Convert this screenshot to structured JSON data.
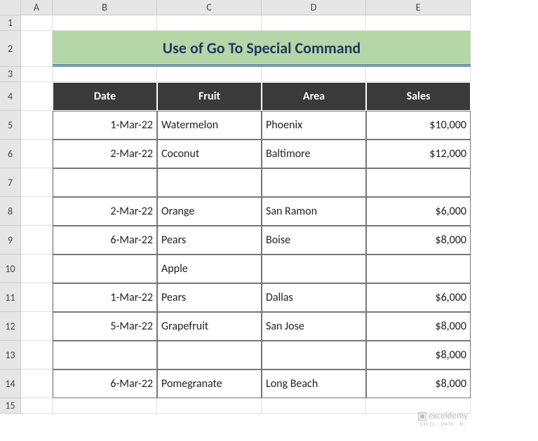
{
  "columns": [
    "A",
    "B",
    "C",
    "D",
    "E"
  ],
  "rows": [
    "1",
    "2",
    "3",
    "4",
    "5",
    "6",
    "7",
    "8",
    "9",
    "10",
    "11",
    "12",
    "13",
    "14",
    "15"
  ],
  "title": "Use of Go To Special Command",
  "headers": {
    "date": "Date",
    "fruit": "Fruit",
    "area": "Area",
    "sales": "Sales"
  },
  "chart_data": {
    "type": "table",
    "columns": [
      "Date",
      "Fruit",
      "Area",
      "Sales"
    ],
    "rows": [
      {
        "date": "1-Mar-22",
        "fruit": "Watermelon",
        "area": "Phoenix",
        "sales": "$10,000"
      },
      {
        "date": "2-Mar-22",
        "fruit": "Coconut",
        "area": "Baltimore",
        "sales": "$12,000"
      },
      {
        "date": "",
        "fruit": "",
        "area": "",
        "sales": ""
      },
      {
        "date": "2-Mar-22",
        "fruit": "Orange",
        "area": "San Ramon",
        "sales": "$6,000"
      },
      {
        "date": "6-Mar-22",
        "fruit": "Pears",
        "area": "Boise",
        "sales": "$8,000"
      },
      {
        "date": "",
        "fruit": "Apple",
        "area": "",
        "sales": ""
      },
      {
        "date": "1-Mar-22",
        "fruit": "Pears",
        "area": "Dallas",
        "sales": "$6,000"
      },
      {
        "date": "5-Mar-22",
        "fruit": "Grapefruit",
        "area": "San Jose",
        "sales": "$8,000"
      },
      {
        "date": "",
        "fruit": "",
        "area": "",
        "sales": "$8,000"
      },
      {
        "date": "6-Mar-22",
        "fruit": "Pomegranate",
        "area": "Long Beach",
        "sales": "$8,000"
      }
    ]
  },
  "watermark": {
    "brand": "exceldemy",
    "tagline": "EXCEL · DATA · BI"
  }
}
